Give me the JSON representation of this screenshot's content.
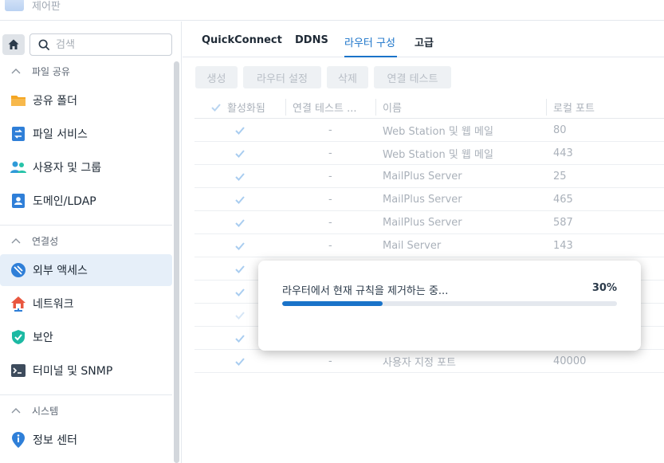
{
  "window": {
    "title": "제어판"
  },
  "search": {
    "placeholder": "검색"
  },
  "sidebar": {
    "sections": [
      {
        "label": "파일 공유",
        "items": [
          {
            "label": "공유 폴더",
            "icon": "folder-icon"
          },
          {
            "label": "파일 서비스",
            "icon": "file-services-icon"
          },
          {
            "label": "사용자 및 그룹",
            "icon": "users-icon"
          },
          {
            "label": "도메인/LDAP",
            "icon": "domain-icon"
          }
        ]
      },
      {
        "label": "연결성",
        "items": [
          {
            "label": "외부 액세스",
            "icon": "external-access-icon",
            "active": true
          },
          {
            "label": "네트워크",
            "icon": "network-icon"
          },
          {
            "label": "보안",
            "icon": "shield-icon"
          },
          {
            "label": "터미널 및 SNMP",
            "icon": "terminal-icon"
          }
        ]
      },
      {
        "label": "시스템",
        "items": [
          {
            "label": "정보 센터",
            "icon": "info-icon"
          }
        ]
      }
    ]
  },
  "tabs": [
    {
      "label": "QuickConnect",
      "active": false
    },
    {
      "label": "DDNS",
      "active": false
    },
    {
      "label": "라우터 구성",
      "active": true
    },
    {
      "label": "고급",
      "active": false
    }
  ],
  "toolbar": {
    "create": "생성",
    "router_settings": "라우터 설정",
    "delete": "삭제",
    "test_connection": "연결 테스트"
  },
  "table": {
    "columns": [
      "활성화됨",
      "연결 테스트 ...",
      "이름",
      "로컬 포트"
    ],
    "rows": [
      {
        "enabled": true,
        "test": "-",
        "name": "Web Station 및 웹 메일",
        "port": "80"
      },
      {
        "enabled": true,
        "test": "-",
        "name": "Web Station 및 웹 메일",
        "port": "443"
      },
      {
        "enabled": true,
        "test": "-",
        "name": "MailPlus Server",
        "port": "25"
      },
      {
        "enabled": true,
        "test": "-",
        "name": "MailPlus Server",
        "port": "465"
      },
      {
        "enabled": true,
        "test": "-",
        "name": "MailPlus Server",
        "port": "587"
      },
      {
        "enabled": true,
        "test": "-",
        "name": "Mail Server",
        "port": "143"
      },
      {
        "enabled": true,
        "test": "",
        "name": "",
        "port": ""
      },
      {
        "enabled": true,
        "test": "",
        "name": "",
        "port": ""
      },
      {
        "enabled": true,
        "test": "",
        "name": "",
        "port": ""
      },
      {
        "enabled": true,
        "test": "",
        "name": "",
        "port": ""
      },
      {
        "enabled": true,
        "test": "-",
        "name": "사용자 지정 포트",
        "port": "40000"
      }
    ]
  },
  "dialog": {
    "message": "라우터에서 현재 규칙을 제거하는 중...",
    "percent_label": "30%",
    "progress": 0.3
  },
  "colors": {
    "accent": "#1a73c9",
    "active_bg": "#e6eff9"
  }
}
